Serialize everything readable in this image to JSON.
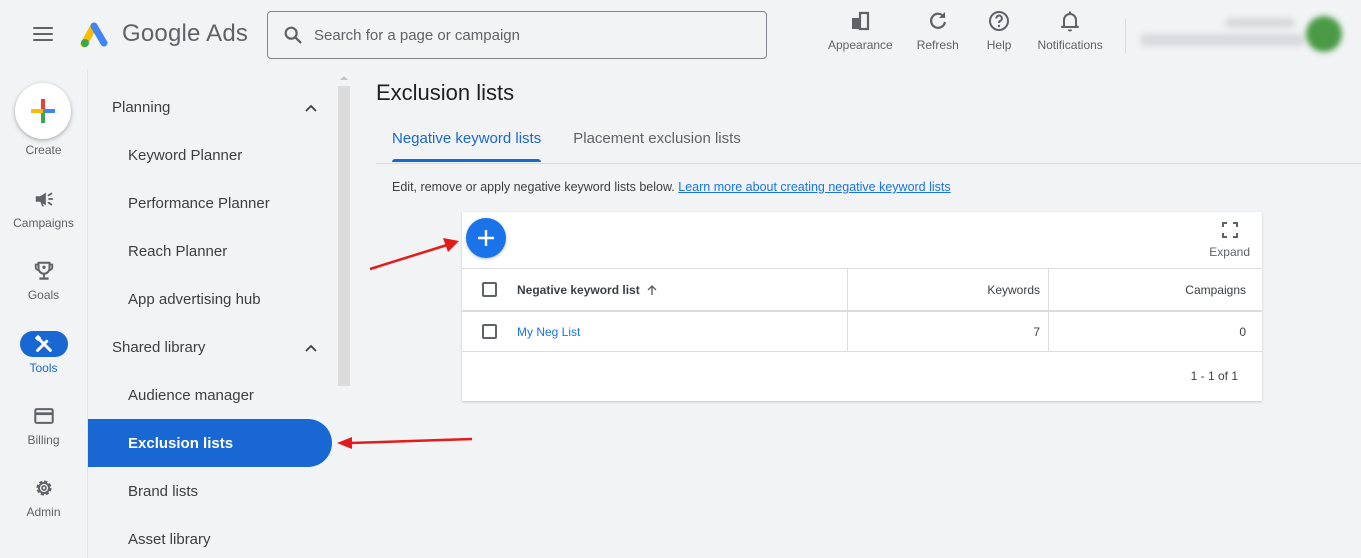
{
  "app": {
    "logo_text": "Google Ads"
  },
  "search": {
    "placeholder": "Search for a page or campaign",
    "value": ""
  },
  "top_actions": [
    {
      "label": "Appearance",
      "icon": "appearance-icon"
    },
    {
      "label": "Refresh",
      "icon": "refresh-icon"
    },
    {
      "label": "Help",
      "icon": "help-icon"
    },
    {
      "label": "Notifications",
      "icon": "bell-icon"
    }
  ],
  "rail": {
    "create_label": "Create",
    "items": [
      {
        "label": "Campaigns",
        "icon": "megaphone-icon"
      },
      {
        "label": "Goals",
        "icon": "trophy-icon"
      },
      {
        "label": "Tools",
        "icon": "tools-icon",
        "active": true
      },
      {
        "label": "Billing",
        "icon": "credit-card-icon"
      },
      {
        "label": "Admin",
        "icon": "gear-icon"
      }
    ]
  },
  "nav": {
    "sections": [
      {
        "label": "Planning",
        "expanded": true,
        "items": [
          {
            "label": "Keyword Planner"
          },
          {
            "label": "Performance Planner"
          },
          {
            "label": "Reach Planner"
          },
          {
            "label": "App advertising hub"
          }
        ]
      },
      {
        "label": "Shared library",
        "expanded": true,
        "items": [
          {
            "label": "Audience manager"
          },
          {
            "label": "Exclusion lists",
            "active": true
          },
          {
            "label": "Brand lists"
          },
          {
            "label": "Asset library"
          }
        ]
      }
    ]
  },
  "main": {
    "title": "Exclusion lists",
    "tabs": [
      {
        "label": "Negative keyword lists",
        "active": true
      },
      {
        "label": "Placement exclusion lists"
      }
    ],
    "description": "Edit, remove or apply negative keyword lists below.",
    "learn_more_link": "Learn more about creating negative keyword lists",
    "expand_label": "Expand",
    "table": {
      "columns": [
        "Negative keyword list",
        "Keywords",
        "Campaigns"
      ],
      "sorted_column": "Negative keyword list",
      "sort_direction": "ascending",
      "rows": [
        {
          "name": "My Neg List",
          "keywords": "7",
          "campaigns": "0"
        }
      ],
      "pagination": "1 - 1 of 1"
    }
  },
  "colors": {
    "accent": "#1967d2",
    "link": "#1a73e8",
    "annotation_arrow": "#e31b1b"
  }
}
